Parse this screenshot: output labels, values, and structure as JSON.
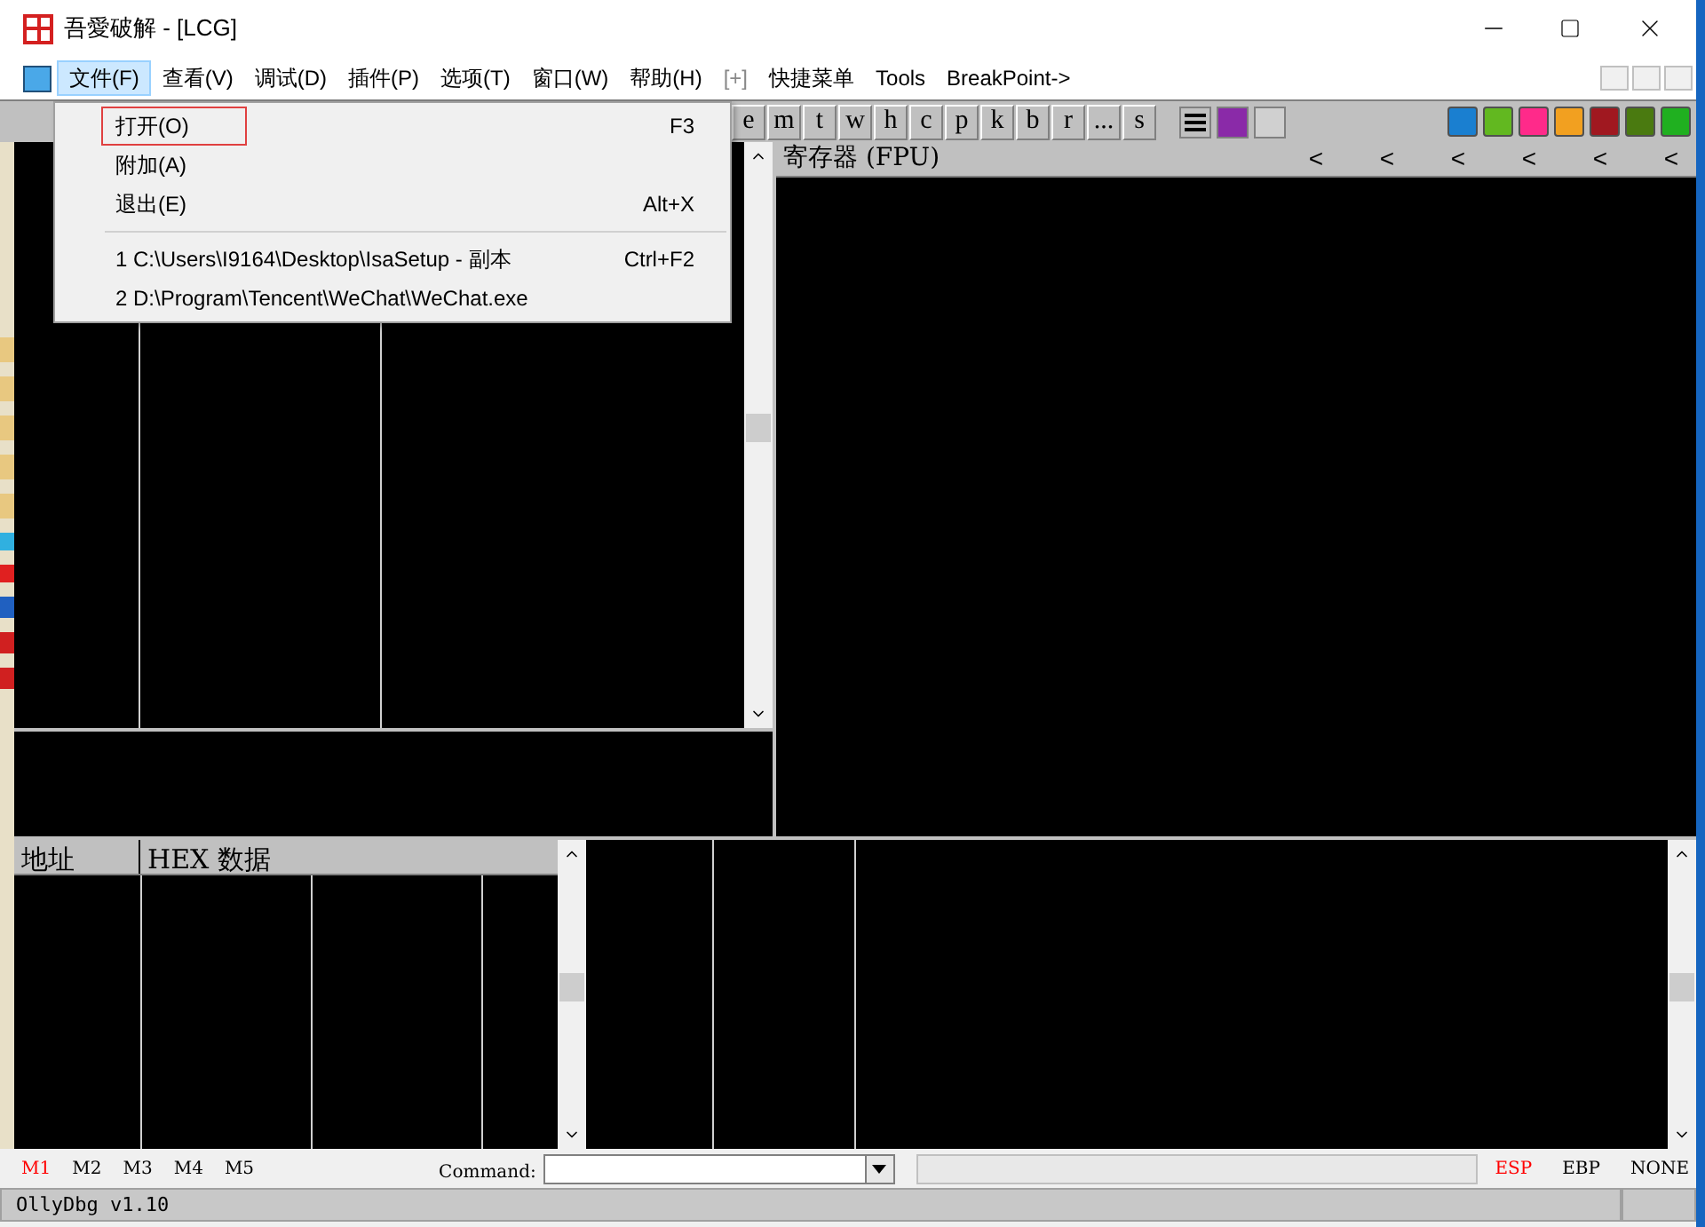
{
  "window": {
    "title": "吾愛破解 - [LCG]"
  },
  "menu": [
    {
      "label": "文件(F)",
      "selected": true,
      "disabled": false
    },
    {
      "label": "查看(V)",
      "selected": false,
      "disabled": false
    },
    {
      "label": "调试(D)",
      "selected": false,
      "disabled": false
    },
    {
      "label": "插件(P)",
      "selected": false,
      "disabled": false
    },
    {
      "label": "选项(T)",
      "selected": false,
      "disabled": false
    },
    {
      "label": "窗口(W)",
      "selected": false,
      "disabled": false
    },
    {
      "label": "帮助(H)",
      "selected": false,
      "disabled": false
    },
    {
      "label": "[+]",
      "selected": false,
      "disabled": true
    },
    {
      "label": "快捷菜单",
      "selected": false,
      "disabled": false
    },
    {
      "label": "Tools",
      "selected": false,
      "disabled": false
    },
    {
      "label": "BreakPoint->",
      "selected": false,
      "disabled": false
    }
  ],
  "toolbar_letters": [
    "e",
    "m",
    "t",
    "w",
    "h",
    "c",
    "p",
    "k",
    "b",
    "r",
    "...",
    "s"
  ],
  "dropdown": {
    "items": [
      {
        "kind": "item",
        "label": "打开(O)",
        "shortcut": "F3",
        "selected": true
      },
      {
        "kind": "item",
        "label": "附加(A)",
        "selected": false
      },
      {
        "kind": "item",
        "label": "退出(E)",
        "shortcut": "Alt+X",
        "selected": false
      },
      {
        "kind": "separator"
      },
      {
        "kind": "item",
        "label": "1 C:\\Users\\I9164\\Desktop\\IsaSetup - 副本",
        "shortcut": "Ctrl+F2",
        "selected": false
      },
      {
        "kind": "item",
        "label": "2 D:\\Program\\Tencent\\WeChat\\WeChat.exe",
        "selected": false
      }
    ]
  },
  "registers": {
    "title": "寄存器 (FPU)",
    "arrows": [
      "<",
      "<",
      "<",
      "<",
      "<",
      "<"
    ]
  },
  "dump": {
    "columns": [
      "地址",
      "HEX 数据"
    ]
  },
  "command_bar": {
    "marks": [
      {
        "label": "M1",
        "selected": true
      },
      {
        "label": "M2",
        "selected": false
      },
      {
        "label": "M3",
        "selected": false
      },
      {
        "label": "M4",
        "selected": false
      },
      {
        "label": "M5",
        "selected": false
      }
    ],
    "command_label": "Command:",
    "regs": [
      {
        "label": "ESP",
        "selected": true
      },
      {
        "label": "EBP",
        "selected": false
      },
      {
        "label": "NONE",
        "selected": false
      }
    ]
  },
  "status_bar": "OllyDbg v1.10"
}
